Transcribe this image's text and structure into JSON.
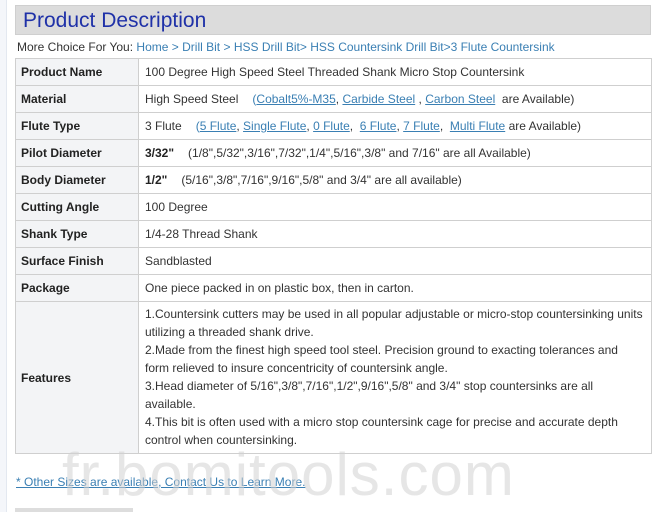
{
  "header": {
    "title": "Product Description"
  },
  "breadcrumb": {
    "lead": "More Choice For You:",
    "items": [
      "Home",
      "Drill Bit",
      "HSS Drill Bit",
      "HSS Countersink Drill Bit",
      "3 Flute Countersink"
    ],
    "separator": ">"
  },
  "specs": {
    "product_name": {
      "label": "Product Name",
      "value": "100 Degree High Speed Steel Threaded Shank Micro Stop Countersink"
    },
    "material": {
      "label": "Material",
      "value": "High Speed Steel",
      "open": "(",
      "options": [
        "Cobalt5%-M35",
        "Carbide Steel",
        "Carbon Steel"
      ],
      "suffix": "are Available)"
    },
    "flute_type": {
      "label": "Flute Type",
      "value": "3 Flute",
      "open": "(",
      "options": [
        "5 Flute",
        "Single Flute",
        "0 Flute",
        "6 Flute",
        "7 Flute",
        "Multi Flute"
      ],
      "suffix": "are Available)"
    },
    "pilot_diameter": {
      "label": "Pilot Diameter",
      "value": "3/32\"",
      "note": "(1/8\",5/32\",3/16\",7/32\",1/4\",5/16\",3/8\" and 7/16\" are all Available)"
    },
    "body_diameter": {
      "label": "Body Diameter",
      "value": "1/2\"",
      "note": "(5/16\",3/8\",7/16\",9/16\",5/8\" and 3/4\" are all available)"
    },
    "cutting_angle": {
      "label": "Cutting Angle",
      "value": "100 Degree"
    },
    "shank_type": {
      "label": "Shank Type",
      "value": "1/4-28 Thread Shank"
    },
    "surface_finish": {
      "label": "Surface Finish",
      "value": "Sandblasted"
    },
    "package": {
      "label": "Package",
      "value": "One piece packed in on plastic box, then in carton."
    },
    "features": {
      "label": "Features",
      "items": [
        "1.Countersink cutters may be used in all popular adjustable or micro-stop countersinking units utilizing a threaded shank drive.",
        "2.Made from the finest high speed tool steel. Precision ground to exacting tolerances and form relieved to insure concentricity of countersink angle.",
        "3.Head diameter of 5/16\",3/8\",7/16\",1/2\",9/16\",5/8\" and 3/4\" stop countersinks are all available.",
        "4.This bit is often used with a micro stop countersink cage for precise and accurate depth control when countersinking."
      ]
    }
  },
  "footer": {
    "note": "* Other Sizes are available, Contact Us to Learn More."
  },
  "watermark": {
    "text": "fr.bomitools.com"
  },
  "colors": {
    "title": "#1f31a8",
    "link": "#3a7fb3",
    "header_bg": "#dcdcdc",
    "label_bg": "#f3f4f6",
    "border": "#cfcfcf"
  }
}
